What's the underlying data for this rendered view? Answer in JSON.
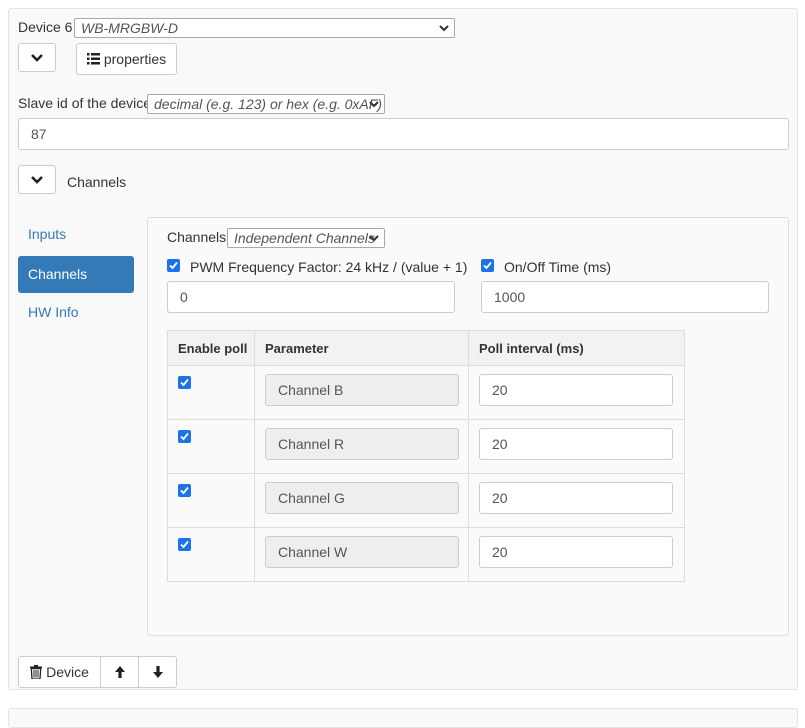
{
  "device": {
    "label": "Device 6",
    "model": "WB-MRGBW-D",
    "properties_label": "properties"
  },
  "slave": {
    "label": "Slave id of the device",
    "format": "decimal (e.g. 123) or hex (e.g. 0xAF)",
    "value": "87"
  },
  "channels_section": {
    "label": "Channels"
  },
  "nav": {
    "items": [
      {
        "label": "Inputs"
      },
      {
        "label": "Channels"
      },
      {
        "label": "HW Info"
      }
    ]
  },
  "channels": {
    "mode_label": "Channels",
    "mode_value": "Independent Channels",
    "pwm": {
      "label": "PWM Frequency Factor: 24 kHz / (value + 1)",
      "value": "0",
      "checked": true
    },
    "onoff": {
      "label": "On/Off Time (ms)",
      "value": "1000",
      "checked": true
    },
    "table": {
      "headers": [
        "Enable poll",
        "Parameter",
        "Poll interval (ms)"
      ],
      "rows": [
        {
          "enabled": true,
          "parameter": "Channel B",
          "interval": "20"
        },
        {
          "enabled": true,
          "parameter": "Channel R",
          "interval": "20"
        },
        {
          "enabled": true,
          "parameter": "Channel G",
          "interval": "20"
        },
        {
          "enabled": true,
          "parameter": "Channel W",
          "interval": "20"
        }
      ]
    }
  },
  "footer": {
    "delete_label": "Device"
  },
  "colors": {
    "accent": "#337ab7",
    "checkbox": "#1a73e8"
  }
}
